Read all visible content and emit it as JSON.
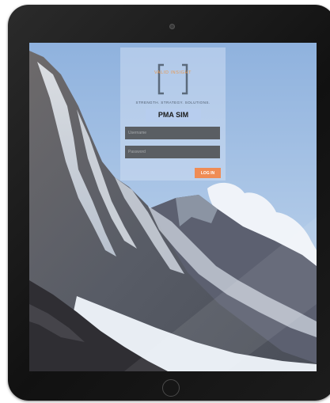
{
  "brand": {
    "logo_text": "VALID INSIGHT",
    "tagline": "STRENGTH. STRATEGY. SOLUTIONS."
  },
  "login": {
    "app_label": "PMA SIM",
    "username_placeholder": "Username",
    "password_placeholder": "Password",
    "login_button_label": "LOG IN"
  },
  "colors": {
    "accent": "#ef8c55",
    "field_bg": "#5a5e63",
    "panel_bg": "#cddcf2",
    "label_bg": "#b7cdee"
  },
  "icons": {
    "logo_mark": "bracket-logo-icon"
  }
}
